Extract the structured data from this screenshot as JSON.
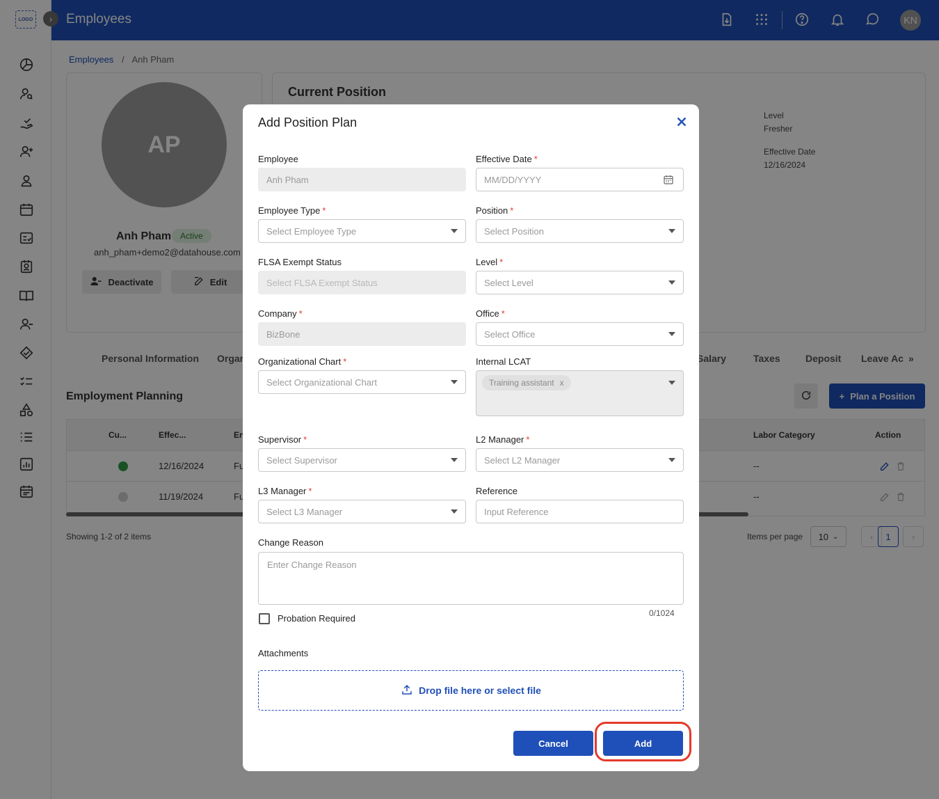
{
  "topbar": {
    "title": "Employees",
    "avatar_initials": "KN",
    "icons": [
      "download-icon",
      "apps-grid-icon",
      "help-icon",
      "bell-icon",
      "chat-icon"
    ]
  },
  "sidebar": {
    "logo_text": "LOGO",
    "icons": [
      "dashboard-icon",
      "person-search-icon",
      "hand-check-icon",
      "add-user-icon",
      "user-icon",
      "calendar-icon",
      "checklist-icon",
      "id-badge-icon",
      "book-icon",
      "remove-user-icon",
      "handshake-icon",
      "tasks-icon",
      "shapes-icon",
      "list-check-icon",
      "report-icon",
      "schedule-icon"
    ]
  },
  "breadcrumb": {
    "root": "Employees",
    "separator": "/",
    "current": "Anh Pham"
  },
  "profile": {
    "initials": "AP",
    "name": "Anh Pham",
    "status": "Active",
    "email": "anh_pham+demo2@datahouse.com",
    "deactivate_label": "Deactivate",
    "edit_label": "Edit"
  },
  "current_position": {
    "title": "Current Position",
    "level_label": "Level",
    "level_value": "Fresher",
    "effective_label": "Effective Date",
    "effective_value": "12/16/2024"
  },
  "tabs": [
    "Personal Information",
    "Organ",
    "Salary",
    "Taxes",
    "Deposit",
    "Leave Ac",
    "»"
  ],
  "employment_planning": {
    "title": "Employment Planning",
    "plan_button": "Plan a Position",
    "columns": [
      "Cu...",
      "Effec...",
      "En",
      "Labor Category",
      "Action"
    ],
    "rows": [
      {
        "current": true,
        "date": "12/16/2024",
        "type": "Fu",
        "labor": "--"
      },
      {
        "current": false,
        "date": "11/19/2024",
        "type": "Fu",
        "labor": "--"
      }
    ],
    "showing": "Showing 1-2 of 2 items",
    "items_per_page_label": "Items per page",
    "items_per_page": "10",
    "page": "1"
  },
  "modal": {
    "title": "Add Position Plan",
    "fields": {
      "employee": {
        "label": "Employee",
        "value": "Anh Pham"
      },
      "effective_date": {
        "label": "Effective Date",
        "placeholder": "MM/DD/YYYY"
      },
      "employee_type": {
        "label": "Employee Type",
        "placeholder": "Select Employee Type"
      },
      "position": {
        "label": "Position",
        "placeholder": "Select Position"
      },
      "flsa": {
        "label": "FLSA Exempt Status",
        "placeholder": "Select FLSA Exempt Status"
      },
      "level": {
        "label": "Level",
        "placeholder": "Select Level"
      },
      "company": {
        "label": "Company",
        "value": "BizBone"
      },
      "office": {
        "label": "Office",
        "placeholder": "Select Office"
      },
      "org_chart": {
        "label": "Organizational Chart",
        "placeholder": "Select Organizational Chart"
      },
      "internal_lcat": {
        "label": "Internal LCAT",
        "chip": "Training assistant",
        "chip_remove": "x"
      },
      "supervisor": {
        "label": "Supervisor",
        "placeholder": "Select Supervisor"
      },
      "l2_manager": {
        "label": "L2 Manager",
        "placeholder": "Select L2 Manager"
      },
      "l3_manager": {
        "label": "L3 Manager",
        "placeholder": "Select L3 Manager"
      },
      "reference": {
        "label": "Reference",
        "placeholder": "Input Reference"
      },
      "change_reason": {
        "label": "Change Reason",
        "placeholder": "Enter Change Reason",
        "counter": "0/1024"
      }
    },
    "required_mark": "*",
    "probation_label": "Probation Required",
    "attachments_label": "Attachments",
    "dropzone_text": "Drop file here or select file",
    "cancel_label": "Cancel",
    "add_label": "Add"
  },
  "colors": {
    "primary": "#1f4fb8",
    "required": "#e53935",
    "highlight": "#e53a2b",
    "active_badge_bg": "#dff1df",
    "active_badge_fg": "#2e7d32"
  }
}
